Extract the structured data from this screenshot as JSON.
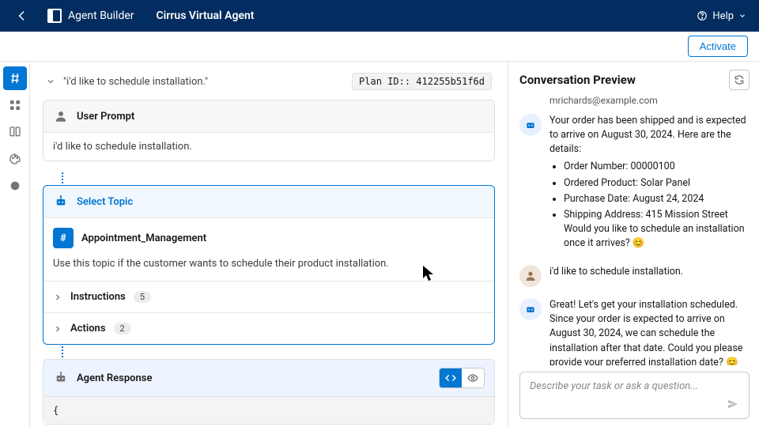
{
  "topbar": {
    "app_label": "Agent Builder",
    "page_title": "Cirrus Virtual Agent",
    "help_label": "Help"
  },
  "subbar": {
    "activate_label": "Activate"
  },
  "crumb": {
    "quote": "\"i'd like to schedule installation.\"",
    "plan_id_label": "Plan ID:: 412255b51f6d"
  },
  "user_prompt_card": {
    "title": "User Prompt",
    "text": "i'd like to schedule installation."
  },
  "select_topic": {
    "title": "Select Topic",
    "topic_name": "Appointment_Management",
    "topic_desc": "Use this topic if the customer wants to schedule their product installation.",
    "instructions_label": "Instructions",
    "instructions_count": "5",
    "actions_label": "Actions",
    "actions_count": "2"
  },
  "agent_response": {
    "title": "Agent Response",
    "code_preview": "{"
  },
  "rightpane": {
    "title": "Conversation Preview",
    "email": "mrichards@example.com",
    "bot_msg_1_intro": "Your order has been shipped and is expected to arrive on August 30, 2024. Here are the details:",
    "bot_msg_1_items": {
      "0": "Order Number: 00000100",
      "1": "Ordered Product: Solar Panel",
      "2": "Purchase Date: August 24, 2024",
      "3": "Shipping Address: 415 Mission Street Would you like to schedule an installation once it arrives? 😊"
    },
    "user_msg_1": "i'd like to schedule installation.",
    "bot_msg_2": "Great! Let's get your installation scheduled. Since your order is expected to arrive on August 30, 2024, we can schedule the installation after that date. Could you please provide your preferred installation date? 😊",
    "input_placeholder": "Describe your task or ask a question..."
  }
}
